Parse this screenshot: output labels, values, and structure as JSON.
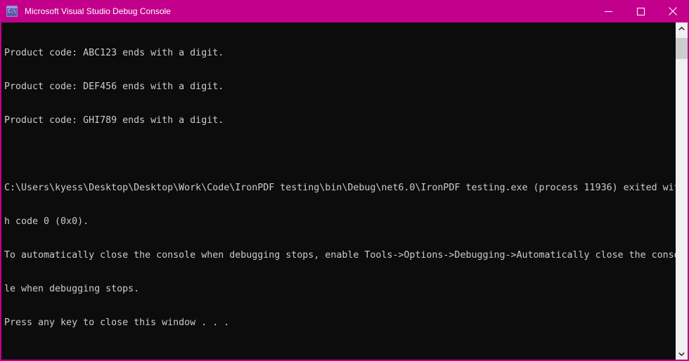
{
  "window": {
    "title": "Microsoft Visual Studio Debug Console",
    "icon_name": "console-app-icon",
    "icon_text": "C:\\",
    "titlebar_color": "#c3008c",
    "title_text_color": "#ffffff",
    "console_bg_color": "#0c0c0c",
    "console_text_color": "#cccccc"
  },
  "controls": {
    "minimize_label": "Minimize",
    "maximize_label": "Maximize",
    "close_label": "Close"
  },
  "console": {
    "lines": [
      "Product code: ABC123 ends with a digit.",
      "Product code: DEF456 ends with a digit.",
      "Product code: GHI789 ends with a digit.",
      "",
      "C:\\Users\\kyess\\Desktop\\Desktop\\Work\\Code\\IronPDF testing\\bin\\Debug\\net6.0\\IronPDF testing.exe (process 11936) exited wit",
      "h code 0 (0x0).",
      "To automatically close the console when debugging stops, enable Tools->Options->Debugging->Automatically close the conso",
      "le when debugging stops.",
      "Press any key to close this window . . ."
    ]
  },
  "scrollbar": {
    "up_label": "Scroll up",
    "down_label": "Scroll down",
    "thumb_label": "Scroll thumb",
    "track_color": "#f0f0f0",
    "thumb_color": "#cdcdcd"
  }
}
